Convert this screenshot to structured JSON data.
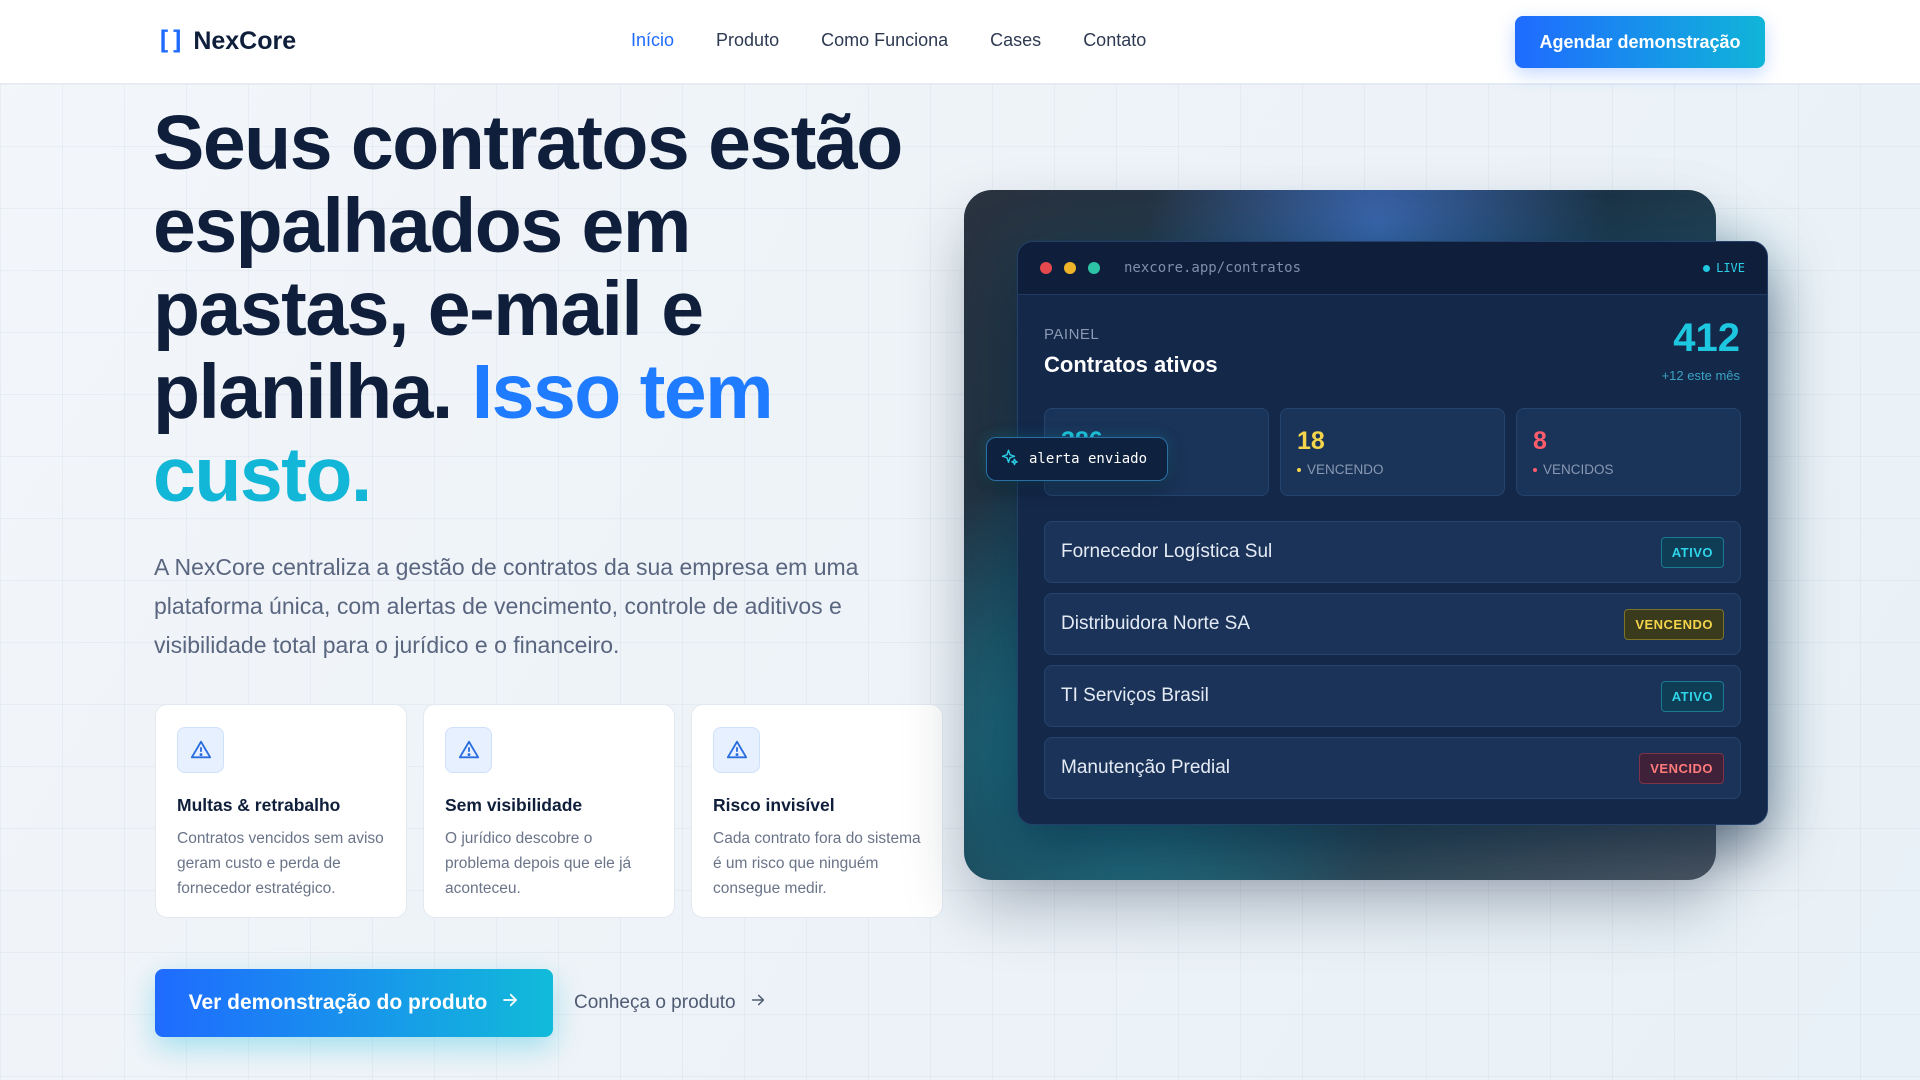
{
  "nav": {
    "logo_mark": "[]",
    "logo_text": "NexCore",
    "links": [
      "Início",
      "Produto",
      "Como Funciona",
      "Cases",
      "Contato"
    ],
    "active_link": "Início",
    "cta": "Agendar demonstração"
  },
  "hero": {
    "title_main": "Seus contratos estão espalhados em pastas, e-mail e planilha.",
    "title_highlight_1": "Isso tem",
    "title_highlight_2": "custo.",
    "subtitle": "A NexCore centraliza a gestão de contratos da sua empresa em uma plataforma única, com alertas de vencimento, controle de aditivos e visibilidade total para o jurídico e o financeiro.",
    "cards": [
      {
        "icon": "warning-icon",
        "title": "Multas & retrabalho",
        "text": "Contratos vencidos sem aviso geram custo e perda de fornecedor estratégico."
      },
      {
        "icon": "warning-icon",
        "title": "Sem visibilidade",
        "text": "O jurídico descobre o problema depois que ele já aconteceu."
      },
      {
        "icon": "warning-icon",
        "title": "Risco invisível",
        "text": "Cada contrato fora do sistema é um risco que ninguém consegue medir."
      }
    ],
    "primary_button": "Ver demonstração do produto",
    "secondary_link": "Conheça o produto"
  },
  "mockup": {
    "url": "nexcore.app/contratos",
    "live": "LIVE",
    "panel_label": "PAINEL",
    "panel_title": "Contratos ativos",
    "total": "412",
    "total_sub": "+12 este mês",
    "stats": [
      {
        "value": "386",
        "label": "",
        "color": "#1ec7e0"
      },
      {
        "value": "18",
        "label": "VENCENDO",
        "color": "#f3d44b"
      },
      {
        "value": "8",
        "label": "VENCIDOS",
        "color": "#ff5c6c"
      }
    ],
    "toast": "alerta enviado",
    "rows": [
      {
        "name": "Fornecedor Logística Sul",
        "status": "ATIVO",
        "kind": "ativo"
      },
      {
        "name": "Distribuidora Norte SA",
        "status": "VENCENDO",
        "kind": "vencendo"
      },
      {
        "name": "TI Serviços Brasil",
        "status": "ATIVO",
        "kind": "ativo"
      },
      {
        "name": "Manutenção Predial",
        "status": "VENCIDO",
        "kind": "vencido"
      }
    ],
    "window_dots": [
      "#e5484d",
      "#f0b429",
      "#2dc3a7"
    ]
  }
}
